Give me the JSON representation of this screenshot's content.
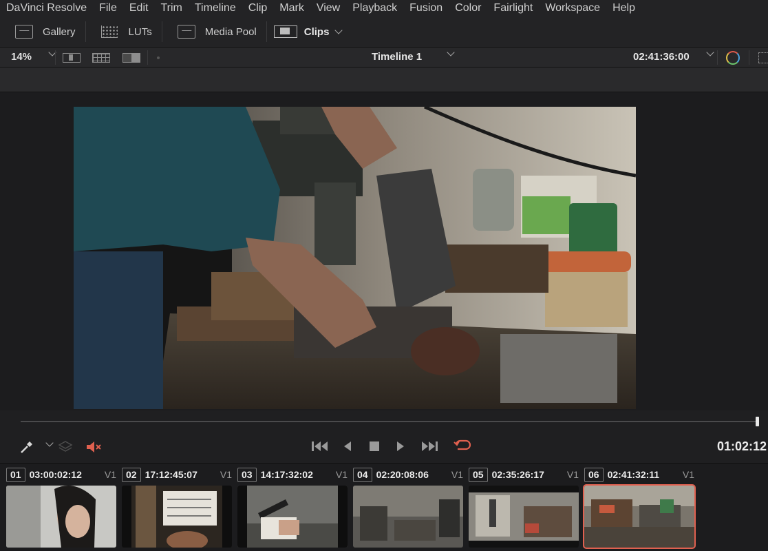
{
  "menu": [
    "DaVinci Resolve",
    "File",
    "Edit",
    "Trim",
    "Timeline",
    "Clip",
    "Mark",
    "View",
    "Playback",
    "Fusion",
    "Color",
    "Fairlight",
    "Workspace",
    "Help"
  ],
  "pagebar": {
    "gallery": "Gallery",
    "luts": "LUTs",
    "media_pool": "Media Pool",
    "clips": "Clips"
  },
  "viewer": {
    "zoom": "14%",
    "timeline_name": "Timeline 1",
    "timecode": "02:41:36:00"
  },
  "transport": {
    "timecode": "01:02:12",
    "icons": [
      "picker-icon",
      "layers-icon",
      "mute-icon",
      "jump-start-icon",
      "reverse-play-icon",
      "stop-icon",
      "play-icon",
      "jump-end-icon",
      "loop-icon"
    ]
  },
  "clips": [
    {
      "num": "01",
      "timecode": "03:00:02:12",
      "track": "V1"
    },
    {
      "num": "02",
      "timecode": "17:12:45:07",
      "track": "V1"
    },
    {
      "num": "03",
      "timecode": "14:17:32:02",
      "track": "V1"
    },
    {
      "num": "04",
      "timecode": "02:20:08:06",
      "track": "V1"
    },
    {
      "num": "05",
      "timecode": "02:35:26:17",
      "track": "V1"
    },
    {
      "num": "06",
      "timecode": "02:41:32:11",
      "track": "V1",
      "selected": true
    }
  ],
  "colors": {
    "accent": "#e0604f",
    "loop": "#e0604f",
    "mute": "#e0604f"
  }
}
